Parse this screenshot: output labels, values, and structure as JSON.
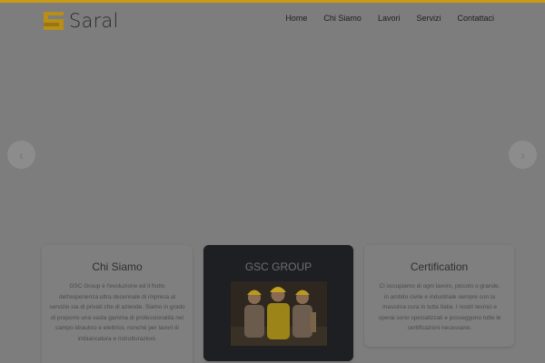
{
  "brand": {
    "name": "Saral"
  },
  "nav": {
    "items": [
      {
        "label": "Home"
      },
      {
        "label": "Chi Siamo"
      },
      {
        "label": "Lavori"
      },
      {
        "label": "Servizi"
      },
      {
        "label": "Contattaci"
      }
    ]
  },
  "slider": {
    "prev_icon": "chevron-left-icon",
    "next_icon": "chevron-right-icon"
  },
  "cards": [
    {
      "title": "Chi Siamo",
      "text": "GSC Group è l'evoluzione ed il frutto dell'esperienza ultra decennale di impresa al servizio sia di privati che di aziende. Siamo in grado di proporre una vasta gamma di professionalità nel campo idraulico e elettrico, nonché per lavori di imbiancatura e ristrutturazioni."
    },
    {
      "title": "GSC GROUP",
      "image": "workers-photo"
    },
    {
      "title": "Certification",
      "text": "Ci occupiamo di ogni lavoro, piccolo o grande, in ambito civile e industriale sempre con la massima cura in tutta Italia. I nostri tecnici e operai sono specializzati e posseggono tutte le certificazioni necessarie."
    }
  ],
  "colors": {
    "accent": "#c99a14",
    "overlay": "#7d7d7d",
    "dark_card": "#1e1f22"
  }
}
